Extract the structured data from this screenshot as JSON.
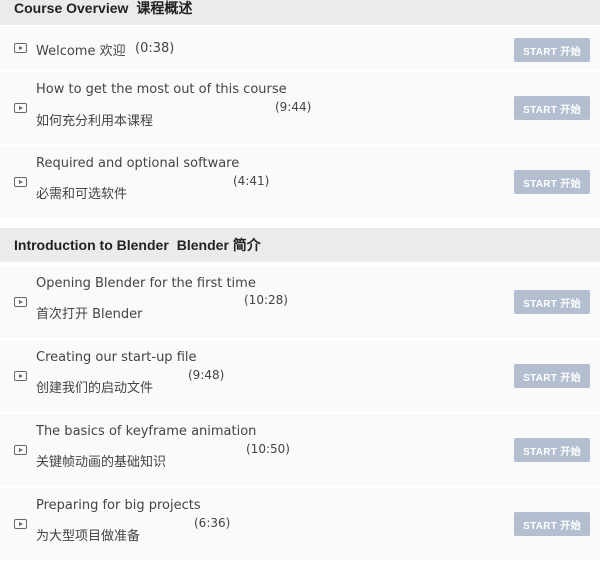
{
  "sections": [
    {
      "title_en": "Course Overview",
      "title_zh": "课程概述",
      "lessons": [
        {
          "line1": "Welcome 欢迎",
          "line2": "",
          "duration": "(0:38)",
          "button": "START 开始"
        },
        {
          "line1": "How to get the most out of this course",
          "line2": "如何充分利用本课程",
          "duration": "(9:44)",
          "button": "START 开始"
        },
        {
          "line1": "Required and optional software",
          "line2": "必需和可选软件",
          "duration": "(4:41)",
          "button": "START 开始"
        }
      ]
    },
    {
      "title_en": "Introduction to Blender",
      "title_zh": "Blender 简介",
      "lessons": [
        {
          "line1": "Opening Blender for the first time",
          "line2": "首次打开 Blender",
          "duration": "(10:28)",
          "button": "START 开始"
        },
        {
          "line1": "Creating our start-up file",
          "line2": "创建我们的启动文件",
          "duration": "(9:48)",
          "button": "START 开始"
        },
        {
          "line1": "The basics of keyframe animation",
          "line2": "关键帧动画的基础知识",
          "duration": "(10:50)",
          "button": "START 开始"
        },
        {
          "line1": "Preparing for big projects",
          "line2": "为大型项目做准备",
          "duration": "(6:36)",
          "button": "START 开始"
        }
      ]
    }
  ]
}
